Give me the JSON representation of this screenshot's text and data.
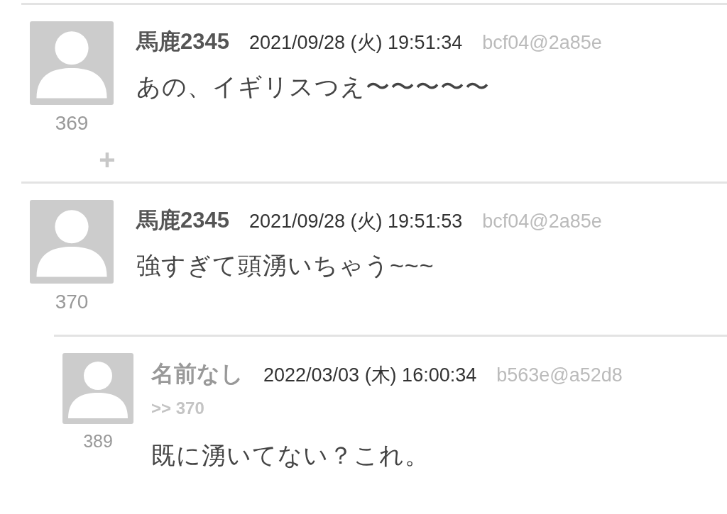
{
  "posts": [
    {
      "name": "馬鹿2345",
      "date": "2021/09/28 (火) 19:51:34",
      "user_id": "bcf04@2a85e",
      "body": "あの、イギリスつえ〜〜〜〜〜",
      "number": "369",
      "toggle": "+"
    },
    {
      "name": "馬鹿2345",
      "date": "2021/09/28 (火) 19:51:53",
      "user_id": "bcf04@2a85e",
      "body": "強すぎて頭湧いちゃう~~~",
      "number": "370",
      "replies": [
        {
          "name": "名前なし",
          "date": "2022/03/03 (木) 16:00:34",
          "user_id": "b563e@a52d8",
          "reply_to": ">> 370",
          "body": "既に湧いてない？これ。",
          "number": "389"
        }
      ]
    }
  ]
}
